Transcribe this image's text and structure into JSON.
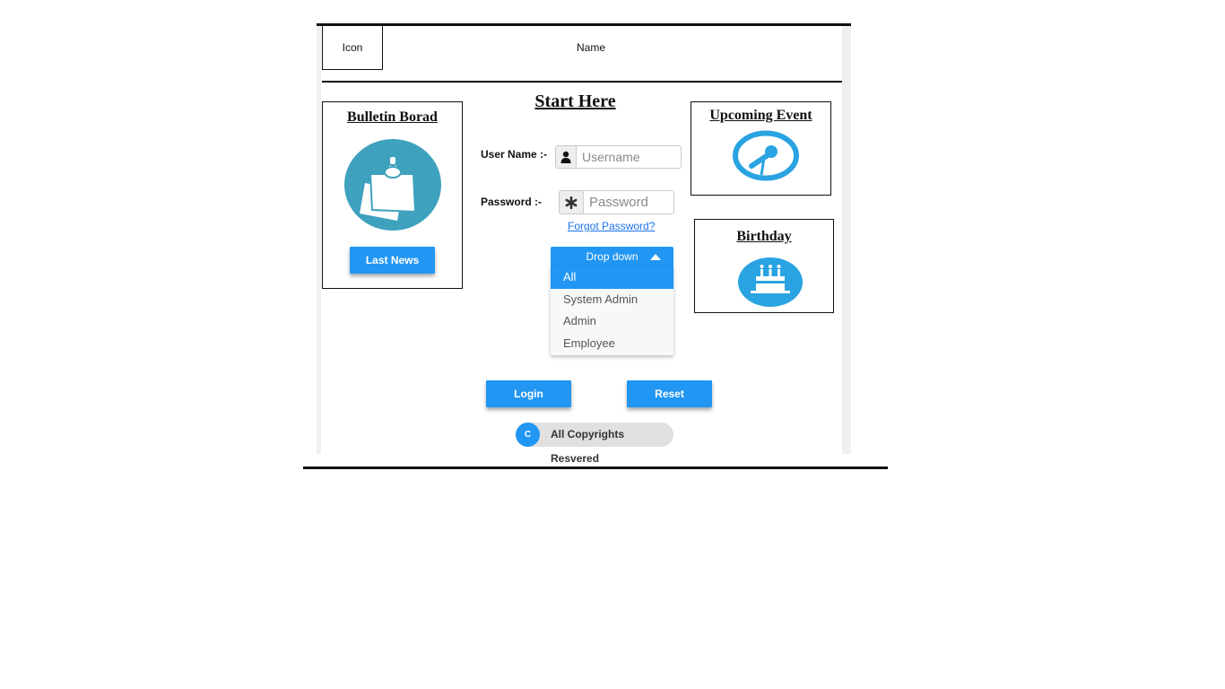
{
  "header": {
    "icon_label": "Icon",
    "name_label": "Name"
  },
  "bulletin": {
    "title": "Bulletin Borad",
    "icon": "sticky-note-pin-icon",
    "button_label": "Last News"
  },
  "login": {
    "title": "Start Here",
    "username_label": "User Name :-",
    "username_placeholder": "Username",
    "username_icon": "user-icon",
    "password_label": "Password :-",
    "password_placeholder": "Password",
    "password_icon": "asterisk-icon",
    "forgot_password": "Forgot Password?",
    "dropdown": {
      "label": "Drop down",
      "selected": "All",
      "options": [
        "All",
        "System Admin",
        "Admin",
        "Employee"
      ]
    },
    "login_button": "Login",
    "reset_button": "Reset"
  },
  "upcoming_event": {
    "title": "Upcoming Event",
    "icon": "microphone-icon"
  },
  "birthday": {
    "title": "Birthday",
    "icon": "birthday-cake-icon"
  },
  "footer": {
    "chip_initial": "C",
    "copyright": "All Copyrights Resvered"
  },
  "colors": {
    "primary": "#2196f3",
    "bulletin_icon_bg": "#3ea1bd",
    "event_icon": "#29a3e1"
  }
}
